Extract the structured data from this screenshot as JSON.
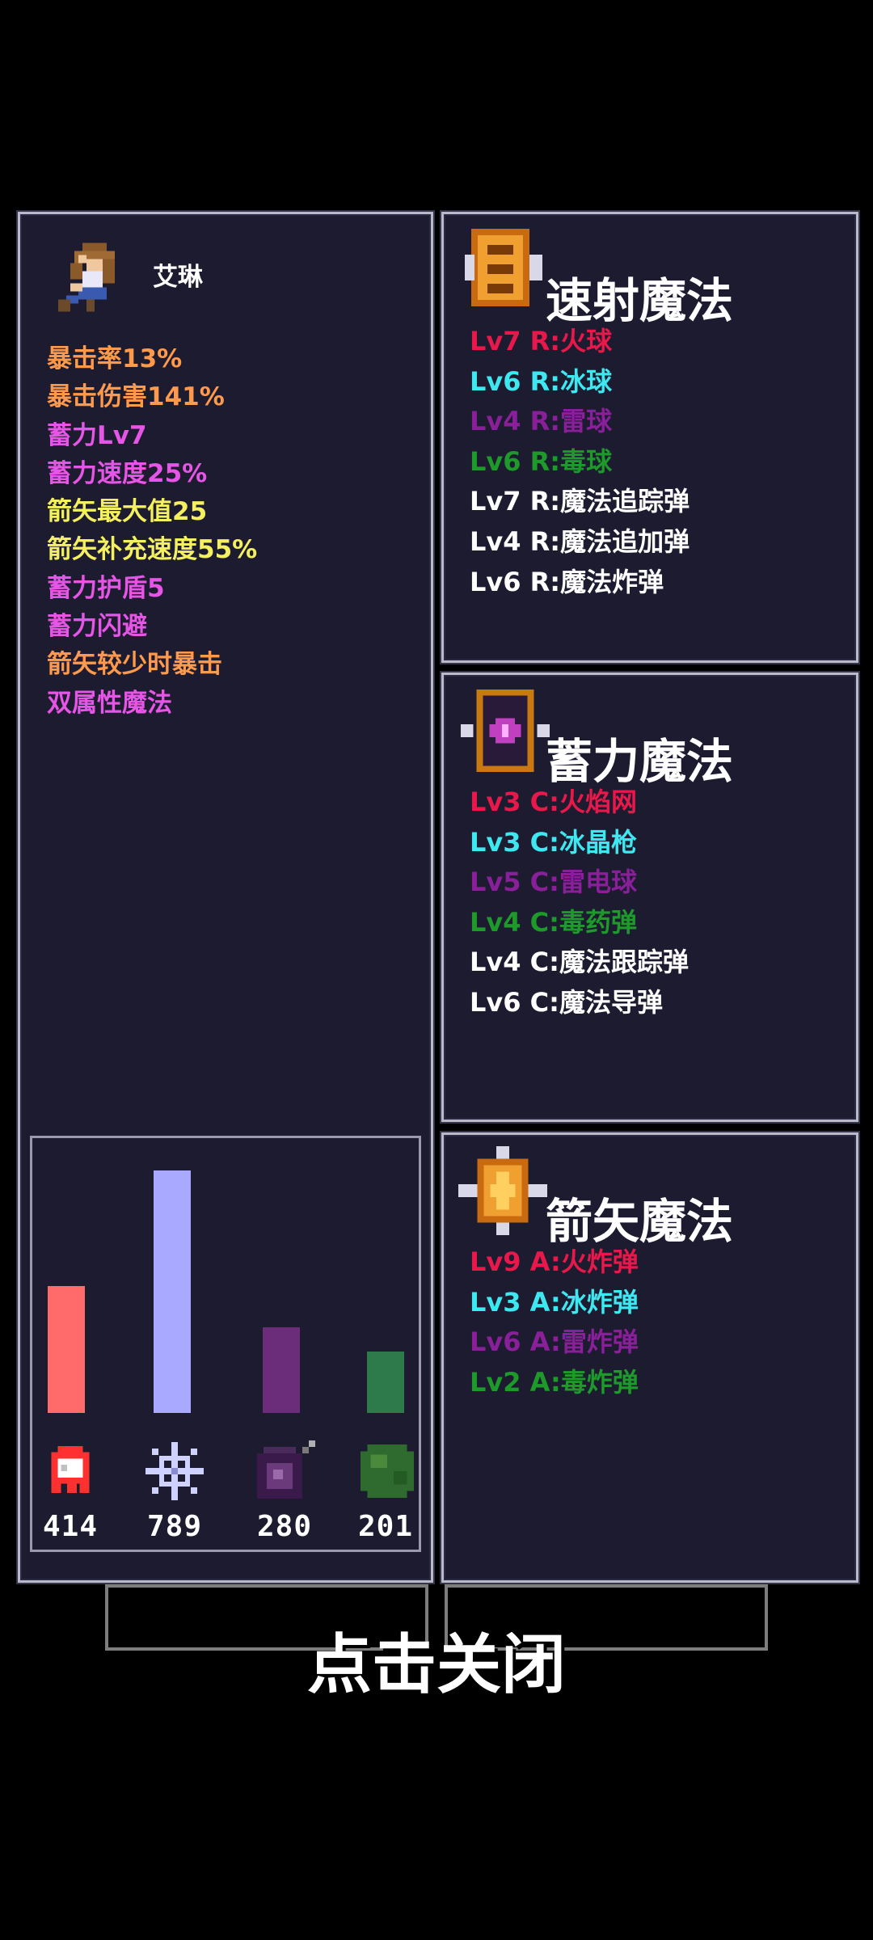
{
  "character": {
    "name": "艾琳",
    "stats": [
      {
        "text": "暴击率13%",
        "color": "#ff9a4d"
      },
      {
        "text": "暴击伤害141%",
        "color": "#ff9a4d"
      },
      {
        "text": "蓄力Lv7",
        "color": "#e655e6"
      },
      {
        "text": "蓄力速度25%",
        "color": "#e655e6"
      },
      {
        "text": "箭矢最大值25",
        "color": "#f4f060"
      },
      {
        "text": "箭矢补充速度55%",
        "color": "#f4f060"
      },
      {
        "text": "蓄力护盾5",
        "color": "#e655e6"
      },
      {
        "text": "蓄力闪避",
        "color": "#e655e6"
      },
      {
        "text": "箭矢较少时暴击",
        "color": "#ff9a4d"
      },
      {
        "text": "双属性魔法",
        "color": "#e655e6"
      }
    ]
  },
  "elements": [
    {
      "icon": "fire-ghost-icon",
      "value": "414",
      "bar_value": 414,
      "bar_color": "#ff6b6b"
    },
    {
      "icon": "ice-snowflake-icon",
      "value": "789",
      "bar_value": 789,
      "bar_color": "#a9a9ff"
    },
    {
      "icon": "thunder-orb-icon",
      "value": "280",
      "bar_value": 280,
      "bar_color": "#6b2d7a"
    },
    {
      "icon": "poison-slime-icon",
      "value": "201",
      "bar_value": 201,
      "bar_color": "#2e7a4a"
    }
  ],
  "colors": {
    "fire": "#e8194a",
    "ice": "#3ee8f0",
    "thunder": "#8a1f9a",
    "poison": "#1d9a2a",
    "neutral": "#ffffff"
  },
  "rapid_magic": {
    "title": "速射魔法",
    "icon": "rapid-scroll-icon",
    "items": [
      {
        "text": "Lv7 R:火球",
        "color": "#e8194a"
      },
      {
        "text": "Lv6 R:冰球",
        "color": "#3ee8f0"
      },
      {
        "text": "Lv4 R:雷球",
        "color": "#8a1f9a"
      },
      {
        "text": "Lv6 R:毒球",
        "color": "#1d9a2a"
      },
      {
        "text": "Lv7 R:魔法追踪弹",
        "color": "#ffffff"
      },
      {
        "text": "Lv4 R:魔法追加弹",
        "color": "#ffffff"
      },
      {
        "text": "Lv6 R:魔法炸弹",
        "color": "#ffffff"
      }
    ]
  },
  "charge_magic": {
    "title": "蓄力魔法",
    "icon": "charge-tome-icon",
    "items": [
      {
        "text": "Lv3 C:火焰网",
        "color": "#e8194a"
      },
      {
        "text": "Lv3 C:冰晶枪",
        "color": "#3ee8f0"
      },
      {
        "text": "Lv5 C:雷电球",
        "color": "#8a1f9a"
      },
      {
        "text": "Lv4 C:毒药弹",
        "color": "#1d9a2a"
      },
      {
        "text": "Lv4 C:魔法跟踪弹",
        "color": "#ffffff"
      },
      {
        "text": "Lv6 C:魔法导弹",
        "color": "#ffffff"
      }
    ]
  },
  "arrow_magic": {
    "title": "箭矢魔法",
    "icon": "arrow-bundle-icon",
    "items": [
      {
        "text": "Lv9 A:火炸弹",
        "color": "#e8194a"
      },
      {
        "text": "Lv3 A:冰炸弹",
        "color": "#3ee8f0"
      },
      {
        "text": "Lv6 A:雷炸弹",
        "color": "#8a1f9a"
      },
      {
        "text": "Lv2 A:毒炸弹",
        "color": "#1d9a2a"
      }
    ]
  },
  "close_label": "点击关闭"
}
